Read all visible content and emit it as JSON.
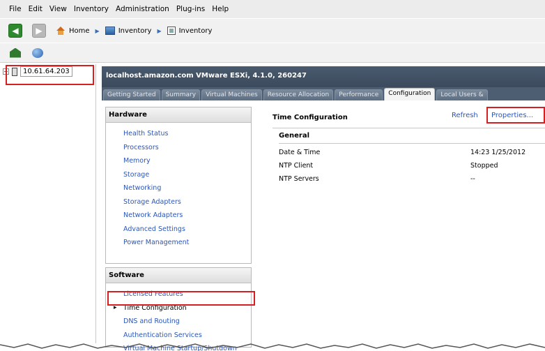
{
  "menu": [
    "File",
    "Edit",
    "View",
    "Inventory",
    "Administration",
    "Plug-ins",
    "Help"
  ],
  "breadcrumb": {
    "home": "Home",
    "item1": "Inventory",
    "item2": "Inventory"
  },
  "tree": {
    "host": "10.61.64.203"
  },
  "host_header": "localhost.amazon.com VMware ESXi, 4.1.0, 260247",
  "tabs": [
    "Getting Started",
    "Summary",
    "Virtual Machines",
    "Resource Allocation",
    "Performance",
    "Configuration",
    "Local Users &"
  ],
  "hardware": {
    "title": "Hardware",
    "items": [
      "Health Status",
      "Processors",
      "Memory",
      "Storage",
      "Networking",
      "Storage Adapters",
      "Network Adapters",
      "Advanced Settings",
      "Power Management"
    ]
  },
  "software": {
    "title": "Software",
    "items": [
      "Licensed Features",
      "Time Configuration",
      "DNS and Routing",
      "Authentication Services",
      "Virtual Machine Startup/Shutdown"
    ]
  },
  "content": {
    "title": "Time Configuration",
    "refresh": "Refresh",
    "properties": "Properties...",
    "section": "General",
    "rows": [
      {
        "label": "Date & Time",
        "value": "14:23  1/25/2012"
      },
      {
        "label": "NTP Client",
        "value": "Stopped"
      },
      {
        "label": "NTP Servers",
        "value": "--"
      }
    ]
  },
  "colors": {
    "highlight": "#d42020",
    "link": "#2a56b8",
    "header": "#3b4a5c"
  }
}
